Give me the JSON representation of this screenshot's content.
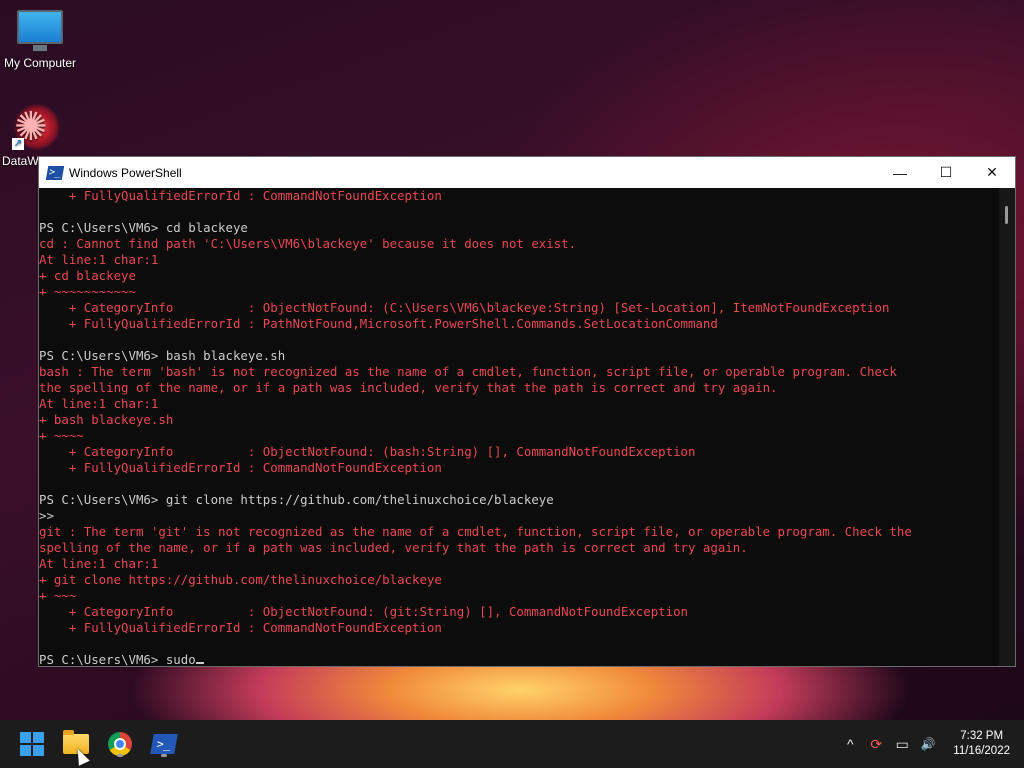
{
  "desktop": {
    "icons": [
      {
        "label": "My Computer",
        "icon": "monitor-icon"
      },
      {
        "label": "DataW",
        "icon": "datawatch-icon"
      }
    ]
  },
  "window": {
    "title": "Windows PowerShell",
    "controls": {
      "minimize": "—",
      "maximize": "☐",
      "close": "✕"
    },
    "console_lines": [
      {
        "cls": "err",
        "text": "    + FullyQualifiedErrorId : CommandNotFoundException"
      },
      {
        "cls": "norm",
        "text": ""
      },
      {
        "cls": "norm",
        "text": "PS C:\\Users\\VM6> cd blackeye"
      },
      {
        "cls": "err",
        "text": "cd : Cannot find path 'C:\\Users\\VM6\\blackeye' because it does not exist."
      },
      {
        "cls": "err",
        "text": "At line:1 char:1"
      },
      {
        "cls": "err",
        "text": "+ cd blackeye"
      },
      {
        "cls": "err",
        "text": "+ ~~~~~~~~~~~"
      },
      {
        "cls": "err",
        "text": "    + CategoryInfo          : ObjectNotFound: (C:\\Users\\VM6\\blackeye:String) [Set-Location], ItemNotFoundException"
      },
      {
        "cls": "err",
        "text": "    + FullyQualifiedErrorId : PathNotFound,Microsoft.PowerShell.Commands.SetLocationCommand"
      },
      {
        "cls": "norm",
        "text": ""
      },
      {
        "cls": "norm",
        "text": "PS C:\\Users\\VM6> bash blackeye.sh"
      },
      {
        "cls": "err",
        "text": "bash : The term 'bash' is not recognized as the name of a cmdlet, function, script file, or operable program. Check"
      },
      {
        "cls": "err",
        "text": "the spelling of the name, or if a path was included, verify that the path is correct and try again."
      },
      {
        "cls": "err",
        "text": "At line:1 char:1"
      },
      {
        "cls": "err",
        "text": "+ bash blackeye.sh"
      },
      {
        "cls": "err",
        "text": "+ ~~~~"
      },
      {
        "cls": "err",
        "text": "    + CategoryInfo          : ObjectNotFound: (bash:String) [], CommandNotFoundException"
      },
      {
        "cls": "err",
        "text": "    + FullyQualifiedErrorId : CommandNotFoundException"
      },
      {
        "cls": "norm",
        "text": ""
      },
      {
        "cls": "norm",
        "text": "PS C:\\Users\\VM6> git clone https://github.com/thelinuxchoice/blackeye"
      },
      {
        "cls": "norm",
        "text": ">>"
      },
      {
        "cls": "err",
        "text": "git : The term 'git' is not recognized as the name of a cmdlet, function, script file, or operable program. Check the"
      },
      {
        "cls": "err",
        "text": "spelling of the name, or if a path was included, verify that the path is correct and try again."
      },
      {
        "cls": "err",
        "text": "At line:1 char:1"
      },
      {
        "cls": "err",
        "text": "+ git clone https://github.com/thelinuxchoice/blackeye"
      },
      {
        "cls": "err",
        "text": "+ ~~~"
      },
      {
        "cls": "err",
        "text": "    + CategoryInfo          : ObjectNotFound: (git:String) [], CommandNotFoundException"
      },
      {
        "cls": "err",
        "text": "    + FullyQualifiedErrorId : CommandNotFoundException"
      },
      {
        "cls": "norm",
        "text": ""
      }
    ],
    "prompt": "PS C:\\Users\\VM6> sudo"
  },
  "taskbar": {
    "clock": {
      "time": "7:32 PM",
      "date": "11/16/2022"
    },
    "tray_icons": {
      "chevron": "^",
      "update": "⟳",
      "network": "▭",
      "volume": "🔊"
    }
  }
}
